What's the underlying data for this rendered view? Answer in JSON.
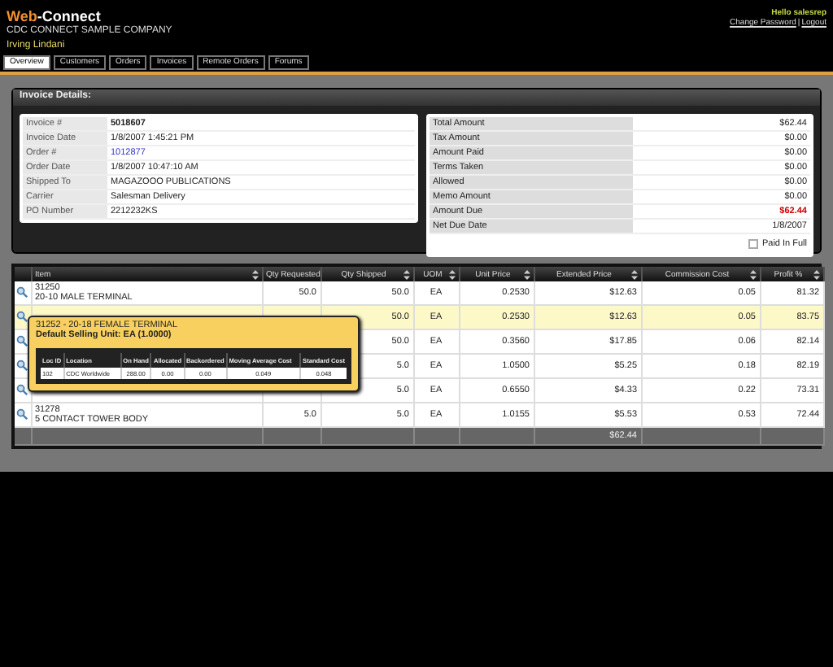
{
  "header": {
    "logo_part_1": "Web",
    "logo_part_2": "-Connect",
    "company": "CDC CONNECT SAMPLE COMPANY",
    "user": "Irving Lindani",
    "greeting": "Hello salesrep",
    "links": [
      "Change Password",
      "Logout"
    ],
    "link_separator": "|"
  },
  "tabs": [
    {
      "label": "Overview",
      "selected": true
    },
    {
      "label": "Customers",
      "selected": false
    },
    {
      "label": "Orders",
      "selected": false
    },
    {
      "label": "Invoices",
      "selected": false
    },
    {
      "label": "Remote Orders",
      "selected": false
    },
    {
      "label": "Forums",
      "selected": false
    }
  ],
  "invoice_details": {
    "title": "Invoice Details:",
    "fields": [
      {
        "label": "Invoice #",
        "value": "5018607",
        "kind": "bold"
      },
      {
        "label": "Invoice Date",
        "value": "1/8/2007 1:45:21 PM",
        "kind": "plain"
      },
      {
        "label": "Order #",
        "value": "1012877",
        "kind": "link"
      },
      {
        "label": "Order Date",
        "value": "1/8/2007 10:47:10 AM",
        "kind": "plain"
      },
      {
        "label": "Shipped To",
        "value": "MAGAZOOO PUBLICATIONS",
        "kind": "plain"
      },
      {
        "label": "Carrier",
        "value": "Salesman Delivery",
        "kind": "plain"
      },
      {
        "label": "PO Number",
        "value": "2212232KS",
        "kind": "plain"
      }
    ],
    "amounts": [
      {
        "label": "Total Amount",
        "value": "$62.44",
        "kind": "plain"
      },
      {
        "label": "Tax Amount",
        "value": "$0.00",
        "kind": "plain"
      },
      {
        "label": "Amount Paid",
        "value": "$0.00",
        "kind": "plain"
      },
      {
        "label": "Terms Taken",
        "value": "$0.00",
        "kind": "plain"
      },
      {
        "label": "Allowed",
        "value": "$0.00",
        "kind": "plain"
      },
      {
        "label": "Memo Amount",
        "value": "$0.00",
        "kind": "plain"
      },
      {
        "label": "Amount Due",
        "value": "$62.44",
        "kind": "alert"
      },
      {
        "label": "Net Due Date",
        "value": "1/8/2007",
        "kind": "plain"
      }
    ],
    "paid_in_full": {
      "label": "Paid In Full",
      "checked": false
    }
  },
  "lines_table": {
    "columns": [
      "Item",
      "Qty Requested",
      "Qty Shipped",
      "UOM",
      "Unit Price",
      "Extended Price",
      "Commission Cost",
      "Profit %"
    ],
    "rows": [
      {
        "item_number": "31250",
        "description": "20-10 MALE TERMINAL",
        "qty_requested": "50.0",
        "qty_shipped": "50.0",
        "uom": "EA",
        "unit_price": "0.2530",
        "extended_price": "$12.63",
        "commission_cost": "0.05",
        "profit": "81.32",
        "selected": false
      },
      {
        "qty_shipped": "50.0",
        "uom": "EA",
        "unit_price": "0.2530",
        "extended_price": "$12.63",
        "commission_cost": "0.05",
        "profit": "83.75",
        "selected": true
      },
      {
        "qty_shipped": "50.0",
        "uom": "EA",
        "unit_price": "0.3560",
        "extended_price": "$17.85",
        "commission_cost": "0.06",
        "profit": "82.14",
        "selected": false
      },
      {
        "qty_shipped": "5.0",
        "uom": "EA",
        "unit_price": "1.0500",
        "extended_price": "$5.25",
        "commission_cost": "0.18",
        "profit": "82.19",
        "selected": false
      },
      {
        "qty_shipped": "5.0",
        "uom": "EA",
        "unit_price": "0.6550",
        "extended_price": "$4.33",
        "commission_cost": "0.22",
        "profit": "73.31",
        "selected": false
      },
      {
        "item_number": "31278",
        "description": "5 CONTACT TOWER BODY",
        "qty_requested": "5.0",
        "qty_shipped": "5.0",
        "uom": "EA",
        "unit_price": "1.0155",
        "extended_price": "$5.53",
        "commission_cost": "0.53",
        "profit": "72.44",
        "selected": false
      }
    ],
    "total_extended_price": "$62.44"
  },
  "tooltip": {
    "title": "31252 - 20-18 FEMALE TERMINAL",
    "subtitle": "Default Selling Unit: EA (1.0000)",
    "columns": [
      "Loc ID",
      "Location",
      "On Hand",
      "Allocated",
      "Backordered",
      "Moving Average Cost",
      "Standard Cost"
    ],
    "rows": [
      [
        "102",
        "CDC Worldwide",
        "288.00",
        "0.00",
        "0.00",
        "0.049",
        "0.048"
      ]
    ]
  }
}
